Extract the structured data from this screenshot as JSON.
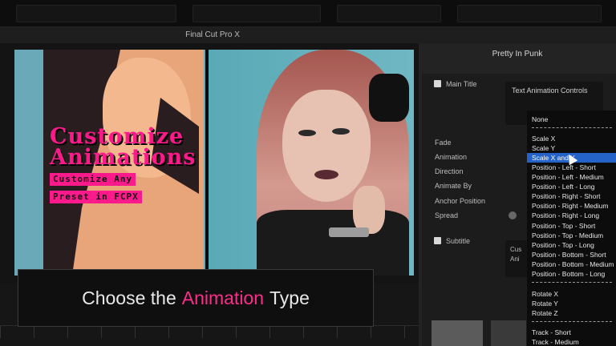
{
  "app": {
    "title": "Final Cut Pro X"
  },
  "video": {
    "title_line1": "Customize",
    "title_line2": "Animations",
    "tag_line1": "Customize Any",
    "tag_line2": "Preset in FCPX"
  },
  "caption": {
    "part1": "Choose the",
    "highlight": "Animation",
    "part2": "Type"
  },
  "inspector": {
    "title": "Pretty In Punk",
    "main_title": "Main Title",
    "text_animation_controls": "Text Animation Controls",
    "labels": [
      "Fade",
      "Animation",
      "Direction",
      "Animate By",
      "Anchor Position",
      "Spread"
    ],
    "subtitle": "Subtitle",
    "sub_box_line1": "Cus",
    "sub_box_line2": "Ani"
  },
  "menu": {
    "items": [
      "None",
      "Scale X",
      "Scale Y",
      "Scale X and Y",
      "Position - Left - Short",
      "Position - Left - Medium",
      "Position - Left - Long",
      "Position - Right - Short",
      "Position - Right - Medium",
      "Position - Right - Long",
      "Position - Top - Short",
      "Position - Top - Medium",
      "Position - Top - Long",
      "Position - Bottom - Short",
      "Position - Bottom - Medium",
      "Position - Bottom - Long",
      "Rotate X",
      "Rotate Y",
      "Rotate Z",
      "Track - Short",
      "Track - Medium"
    ],
    "selected": "Scale X and Y"
  },
  "colors": {
    "accent_pink": "#ff1a8c",
    "menu_selection": "#2563c9"
  }
}
